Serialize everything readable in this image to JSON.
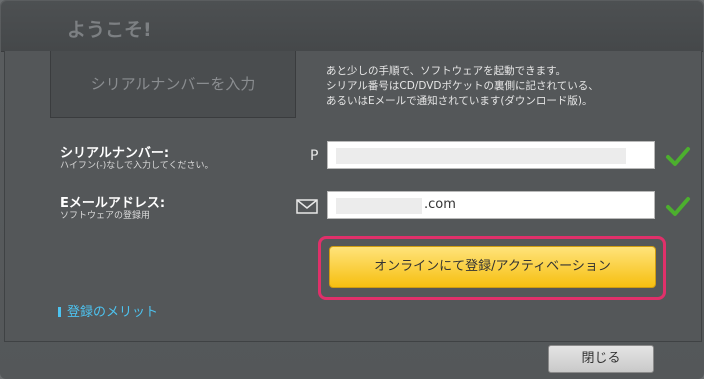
{
  "window": {
    "title": "ようこそ!"
  },
  "tab": {
    "label": "シリアルナンバーを入力"
  },
  "info": {
    "line1": "あと少しの手順で、ソフトウェアを起動できます。",
    "line2": "シリアル番号はCD/DVDポケットの裏側に記されている、",
    "line3": "あるいはEメールで通知されています(ダウンロード版)。"
  },
  "serial": {
    "label": "シリアルナンバー:",
    "sublabel": "ハイフン(-)なしで入力してください。",
    "prefix": "P",
    "value": ""
  },
  "email": {
    "label": "Eメールアドレス:",
    "sublabel": "ソフトウェアの登録用",
    "prefix_icon": "envelope-icon",
    "value": ".com"
  },
  "buttons": {
    "register": "オンラインにて登録/アクティベーション",
    "close": "閉じる"
  },
  "links": {
    "merit": "登録のメリット"
  },
  "colors": {
    "accent_check": "#4caf2e",
    "highlight": "#e0306a",
    "link": "#4dc3f0",
    "primary_button": "#f6c21a"
  }
}
